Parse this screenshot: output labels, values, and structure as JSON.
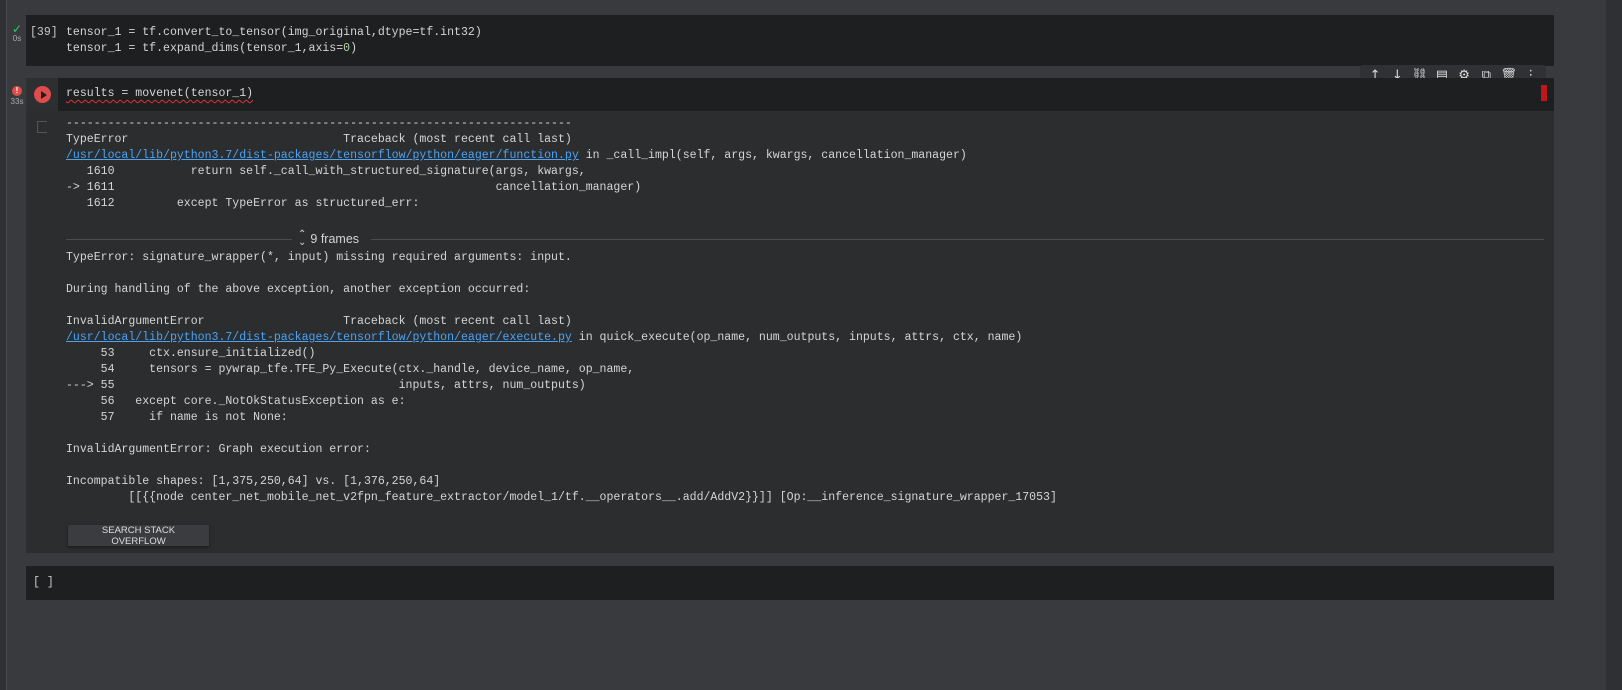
{
  "cells": [
    {
      "status": "success",
      "duration": "0s",
      "execution_count": "[39]",
      "code_lines": [
        {
          "pre": "tensor_1 = tf.convert_to_tensor(img_original,dtype=tf.int32)"
        },
        {
          "pre": "tensor_1 = tf.expand_dims(tensor_1,axis=",
          "num": "0",
          "post": ")"
        }
      ]
    },
    {
      "status": "error",
      "duration": "33s",
      "code": "results = movenet(tensor_1)",
      "output": {
        "block_a": [
          {
            "text": "-------------------------------------------------------------------------"
          },
          {
            "text": "TypeError                               Traceback (most recent call last)"
          },
          {
            "link": "/usr/local/lib/python3.7/dist-packages/tensorflow/python/eager/function.py",
            "text": " in _call_impl(self, args, kwargs, cancellation_manager)"
          },
          {
            "text": "   1610           return self._call_with_structured_signature(args, kwargs,"
          },
          {
            "text": "-> 1611                                                       cancellation_manager)"
          },
          {
            "text": "   1612         except TypeError as structured_err:"
          }
        ],
        "frames_label": "9 frames",
        "block_b": [
          {
            "text": "TypeError: signature_wrapper(*, input) missing required arguments: input."
          },
          {
            "text": ""
          },
          {
            "text": "During handling of the above exception, another exception occurred:"
          },
          {
            "text": ""
          },
          {
            "text": "InvalidArgumentError                    Traceback (most recent call last)"
          },
          {
            "link": "/usr/local/lib/python3.7/dist-packages/tensorflow/python/eager/execute.py",
            "text": " in quick_execute(op_name, num_outputs, inputs, attrs, ctx, name)"
          },
          {
            "text": "     53     ctx.ensure_initialized()"
          },
          {
            "text": "     54     tensors = pywrap_tfe.TFE_Py_Execute(ctx._handle, device_name, op_name,"
          },
          {
            "text": "---> 55                                         inputs, attrs, num_outputs)"
          },
          {
            "text": "     56   except core._NotOkStatusException as e:"
          },
          {
            "text": "     57     if name is not None:"
          },
          {
            "text": ""
          },
          {
            "text": "InvalidArgumentError: Graph execution error:"
          },
          {
            "text": ""
          },
          {
            "text": "Incompatible shapes: [1,375,250,64] vs. [1,376,250,64]"
          },
          {
            "text": "         [[{{node center_net_mobile_net_v2fpn_feature_extractor/model_1/tf.__operators__.add/AddV2}}]] [Op:__inference_signature_wrapper_17053]"
          }
        ],
        "button_label": "SEARCH STACK OVERFLOW"
      }
    },
    {
      "status": "idle",
      "execution_count": "[ ]"
    }
  ],
  "toolbar": {
    "icons": [
      "arrow-up-icon",
      "arrow-down-icon",
      "link-icon",
      "comment-icon",
      "gear-icon",
      "mirror-cell-icon",
      "trash-icon",
      "more-vert-icon"
    ]
  },
  "colors": {
    "success": "#2ecc71",
    "error": "#e04b4b",
    "link": "#4aa3f5",
    "accent_marker": "#c0161a"
  }
}
